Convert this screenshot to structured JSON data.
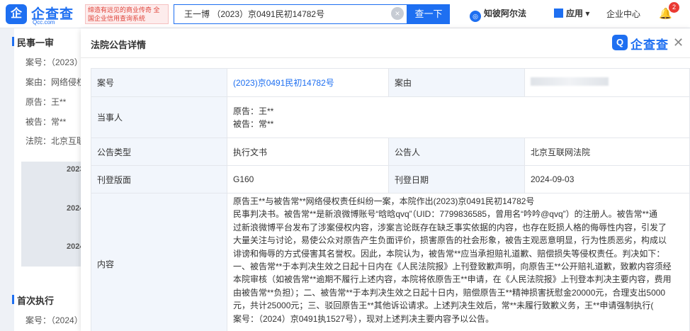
{
  "topbar": {
    "logo_mark": "企",
    "logo_text": "企查查",
    "logo_url": "Qcc.com",
    "slogan": "缔造有远见的商业传奇 全国企业信用查询系统",
    "search_value": "王一博 （2023）京0491民初14782号",
    "search_button": "查一下",
    "nav_zhibi": "知彼阿尔法",
    "nav_app": "应用",
    "nav_enterprise": "企业中心",
    "bell_badge": "2"
  },
  "background": {
    "section1": "民事一审",
    "lines": [
      "案号：（2023）",
      "案由：网络侵权",
      "原告：王**",
      "被告：常**",
      "法院：北京互联"
    ],
    "years": [
      "2023",
      "2024",
      "2024"
    ],
    "section2": "首次执行",
    "lines2": [
      "案号：（2024）"
    ]
  },
  "modal": {
    "title": "法院公告详情",
    "brand_mark": "Q",
    "brand_text": "企查查",
    "rows": {
      "case_no_label": "案号",
      "case_no_value": "(2023)京0491民初14782号",
      "cause_label": "案由",
      "party_label": "当事人",
      "plaintiff": "原告：王**",
      "defendant": "被告：常**",
      "type_label": "公告类型",
      "type_value": "执行文书",
      "announcer_label": "公告人",
      "announcer_value": "北京互联网法院",
      "page_label": "刊登版面",
      "page_value": "G160",
      "date_label": "刊登日期",
      "date_value": "2024-09-03",
      "content_label": "内容",
      "content_lines": [
        "原告王**与被告常**网络侵权责任纠纷一案，本院作出(2023)京0491民初14782号",
        "民事判决书。被告常**是新浪微博账号“晗晗qvq”（UID：7799836585，曾用名“吟吟@qvq”）的注册人。被告常**通",
        "过新浪微博平台发布了涉案侵权内容，涉案言论既存在缺乏事实依据的内容，也存在贬损人格的侮辱性内容，引发了",
        "大量关注与讨论，易使公众对原告产生负面评价，损害原告的社会形象，被告主观恶意明显，行为性质恶劣，构成以",
        "诽谤和侮辱的方式侵害其名誉权。因此，本院认为，被告常**应当承担赔礼道歉、赔偿损失等侵权责任。判决如下：",
        "一、被告常**于本判决生效之日起十日内在《人民法院报》上刊登致歉声明，向原告王**公开赔礼道歉，致歉内容须经",
        "本院审核（如被告常**逾期不履行上述内容，本院将依原告王**申请，在《人民法院报》上刊登本判决主要内容，费用",
        "由被告常**负担）；二、被告常**于本判决生效之日起十日内，赔偿原告王**精神损害抚慰金20000元，合理支出5000",
        "元，共计25000元；三、驳回原告王**其他诉讼请求。上述判决生效后，常**未履行致歉义务，王**申请强制执行(",
        "案号：（2024）京0491执1527号），现对上述判决主要内容予以公告。"
      ]
    }
  }
}
